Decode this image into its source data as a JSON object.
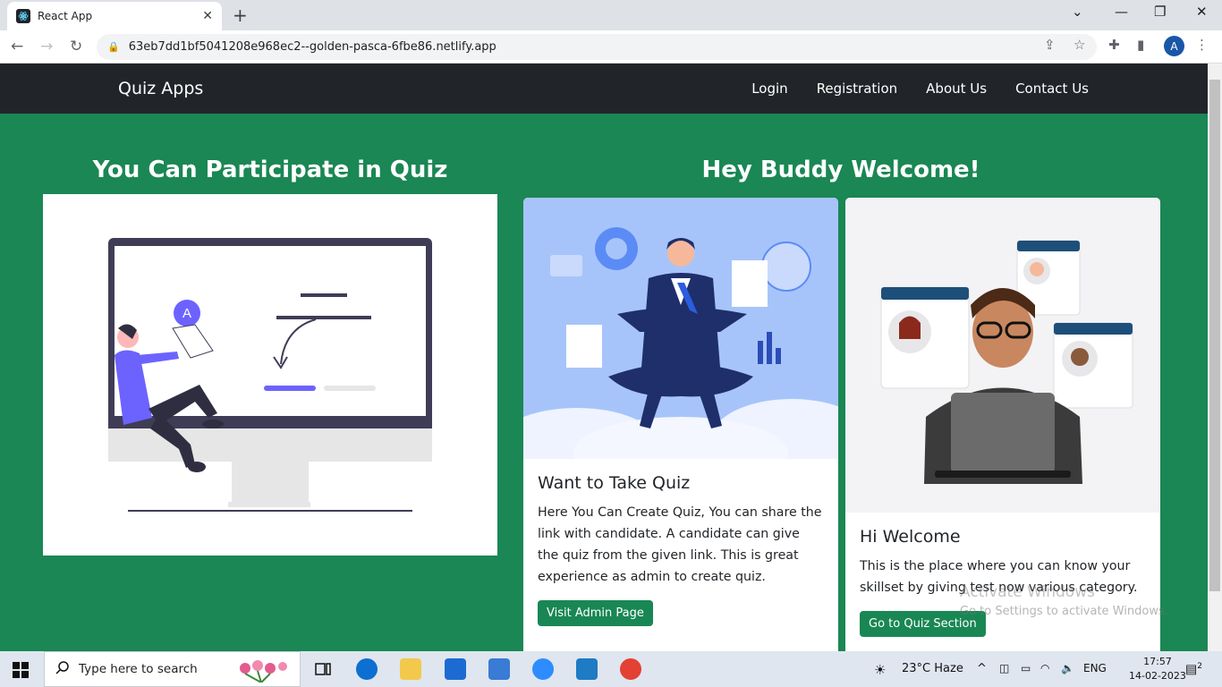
{
  "browser": {
    "tab_title": "React App",
    "url": "63eb7dd1bf5041208e968ec2--golden-pasca-6fbe86.netlify.app",
    "profile_initial": "A"
  },
  "navbar": {
    "brand": "Quiz Apps",
    "links": [
      "Login",
      "Registration",
      "About Us",
      "Contact Us"
    ]
  },
  "left_heading": "You Can Participate in Quiz",
  "right_heading": "Hey Buddy Welcome!",
  "illustration": {
    "badge_letter": "A"
  },
  "card1": {
    "title": "Want to Take Quiz",
    "text": "Here You Can Create Quiz, You can share the link with candidate. A candidate can give the quiz from the given link. This is great experience as admin to create quiz.",
    "button": "Visit Admin Page"
  },
  "card2": {
    "title": "Hi Welcome",
    "text": "This is the place where you can know your skillset by giving test now various category.",
    "button": "Go to Quiz Section"
  },
  "watermark": {
    "line1": "Activate Windows",
    "line2": "Go to Settings to activate Windows."
  },
  "taskbar": {
    "search_placeholder": "Type here to search",
    "weather": "23°C  Haze",
    "language": "ENG",
    "time": "17:57",
    "date": "14-02-2023",
    "notification_count": "2"
  }
}
